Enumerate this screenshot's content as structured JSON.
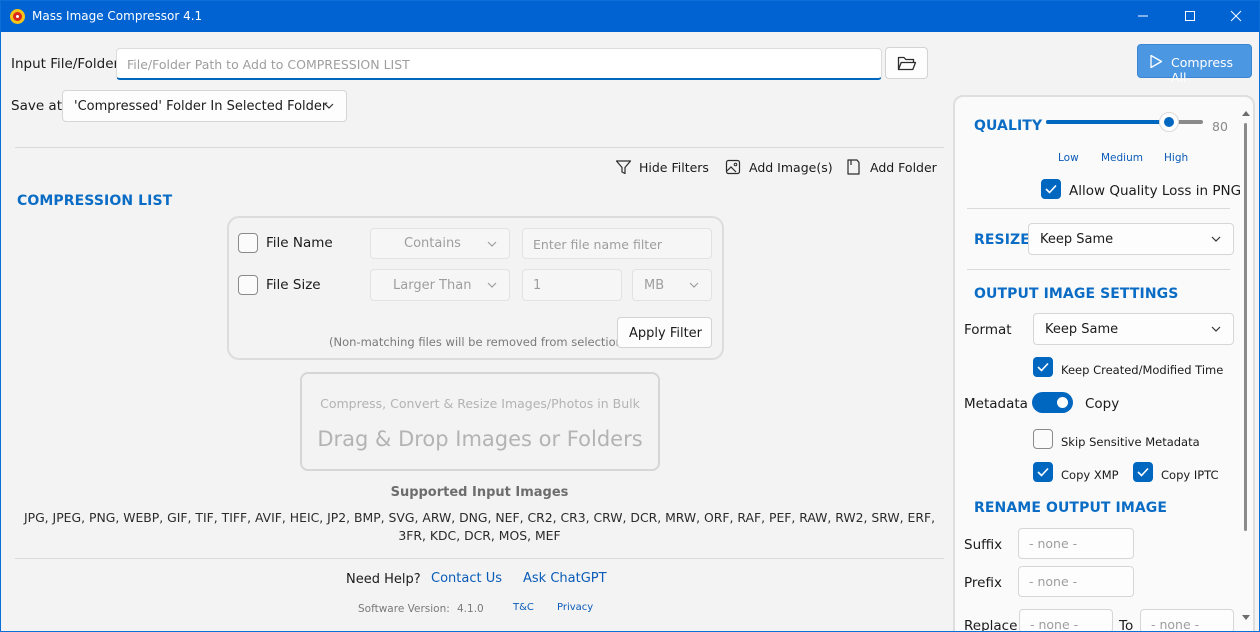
{
  "window": {
    "title": "Mass Image Compressor 4.1"
  },
  "input": {
    "label": "Input File/Folder",
    "placeholder": "File/Folder Path to Add to COMPRESSION LIST"
  },
  "save": {
    "label": "Save at",
    "value": "'Compressed' Folder In Selected Folder"
  },
  "compress_all": "Compress All",
  "toolbar": {
    "hide_filters": "Hide Filters",
    "add_images": "Add Image(s)",
    "add_folder": "Add Folder"
  },
  "compression_list": {
    "title": "COMPRESSION LIST"
  },
  "filters": {
    "file_name": {
      "label": "File Name",
      "operator": "Contains",
      "placeholder": "Enter file name filter",
      "checked": false
    },
    "file_size": {
      "label": "File Size",
      "operator": "Larger Than",
      "value": "1",
      "unit": "MB",
      "checked": false
    },
    "note": "(Non-matching files will be removed from selection)",
    "apply": "Apply Filter"
  },
  "drop_zone": {
    "subtitle": "Compress, Convert & Resize Images/Photos in Bulk",
    "title": "Drag & Drop Images or Folders"
  },
  "supported": {
    "title": "Supported Input Images",
    "line1": "JPG, JPEG, PNG, WEBP, GIF, TIF, TIFF, AVIF, HEIC, JP2, BMP, SVG, ARW, DNG, NEF, CR2, CR3, CRW, DCR, MRW, ORF, RAF, PEF, RAW, RW2, SRW, ERF,",
    "line2": "3FR, KDC, DCR, MOS, MEF"
  },
  "footer": {
    "need_help": "Need Help?",
    "contact": "Contact Us",
    "ask": "Ask ChatGPT",
    "version_label": "Software Version:",
    "version": "4.1.0",
    "tc": "T&C",
    "privacy": "Privacy"
  },
  "quality": {
    "title": "QUALITY",
    "value": 80,
    "value_text": "80",
    "min": 0,
    "max": 100,
    "low": "Low",
    "medium": "Medium",
    "high": "High",
    "allow_loss_png": "Allow Quality Loss in PNG",
    "allow_loss_checked": true
  },
  "resize": {
    "title": "RESIZE",
    "value": "Keep Same"
  },
  "output": {
    "title": "OUTPUT IMAGE SETTINGS",
    "format_label": "Format",
    "format_value": "Keep Same",
    "keep_time": "Keep Created/Modified Time",
    "keep_time_checked": true,
    "metadata_label": "Metadata",
    "metadata_toggle": "Copy",
    "metadata_on": true,
    "skip_sensitive": "Skip Sensitive Metadata",
    "skip_sensitive_checked": false,
    "copy_xmp": "Copy XMP",
    "copy_xmp_checked": true,
    "copy_iptc": "Copy IPTC",
    "copy_iptc_checked": true
  },
  "rename": {
    "title": "RENAME OUTPUT IMAGE",
    "suffix_label": "Suffix",
    "suffix_placeholder": "- none -",
    "prefix_label": "Prefix",
    "prefix_placeholder": "- none -",
    "replace_label": "Replace",
    "replace_placeholder": "- none -",
    "to_label": "To",
    "to_placeholder": "- none -"
  },
  "colors": {
    "titlebar": "#0063d1",
    "accent": "#0067c0",
    "section_title": "#0a6cc4",
    "compress_button": "#4c97e2"
  }
}
